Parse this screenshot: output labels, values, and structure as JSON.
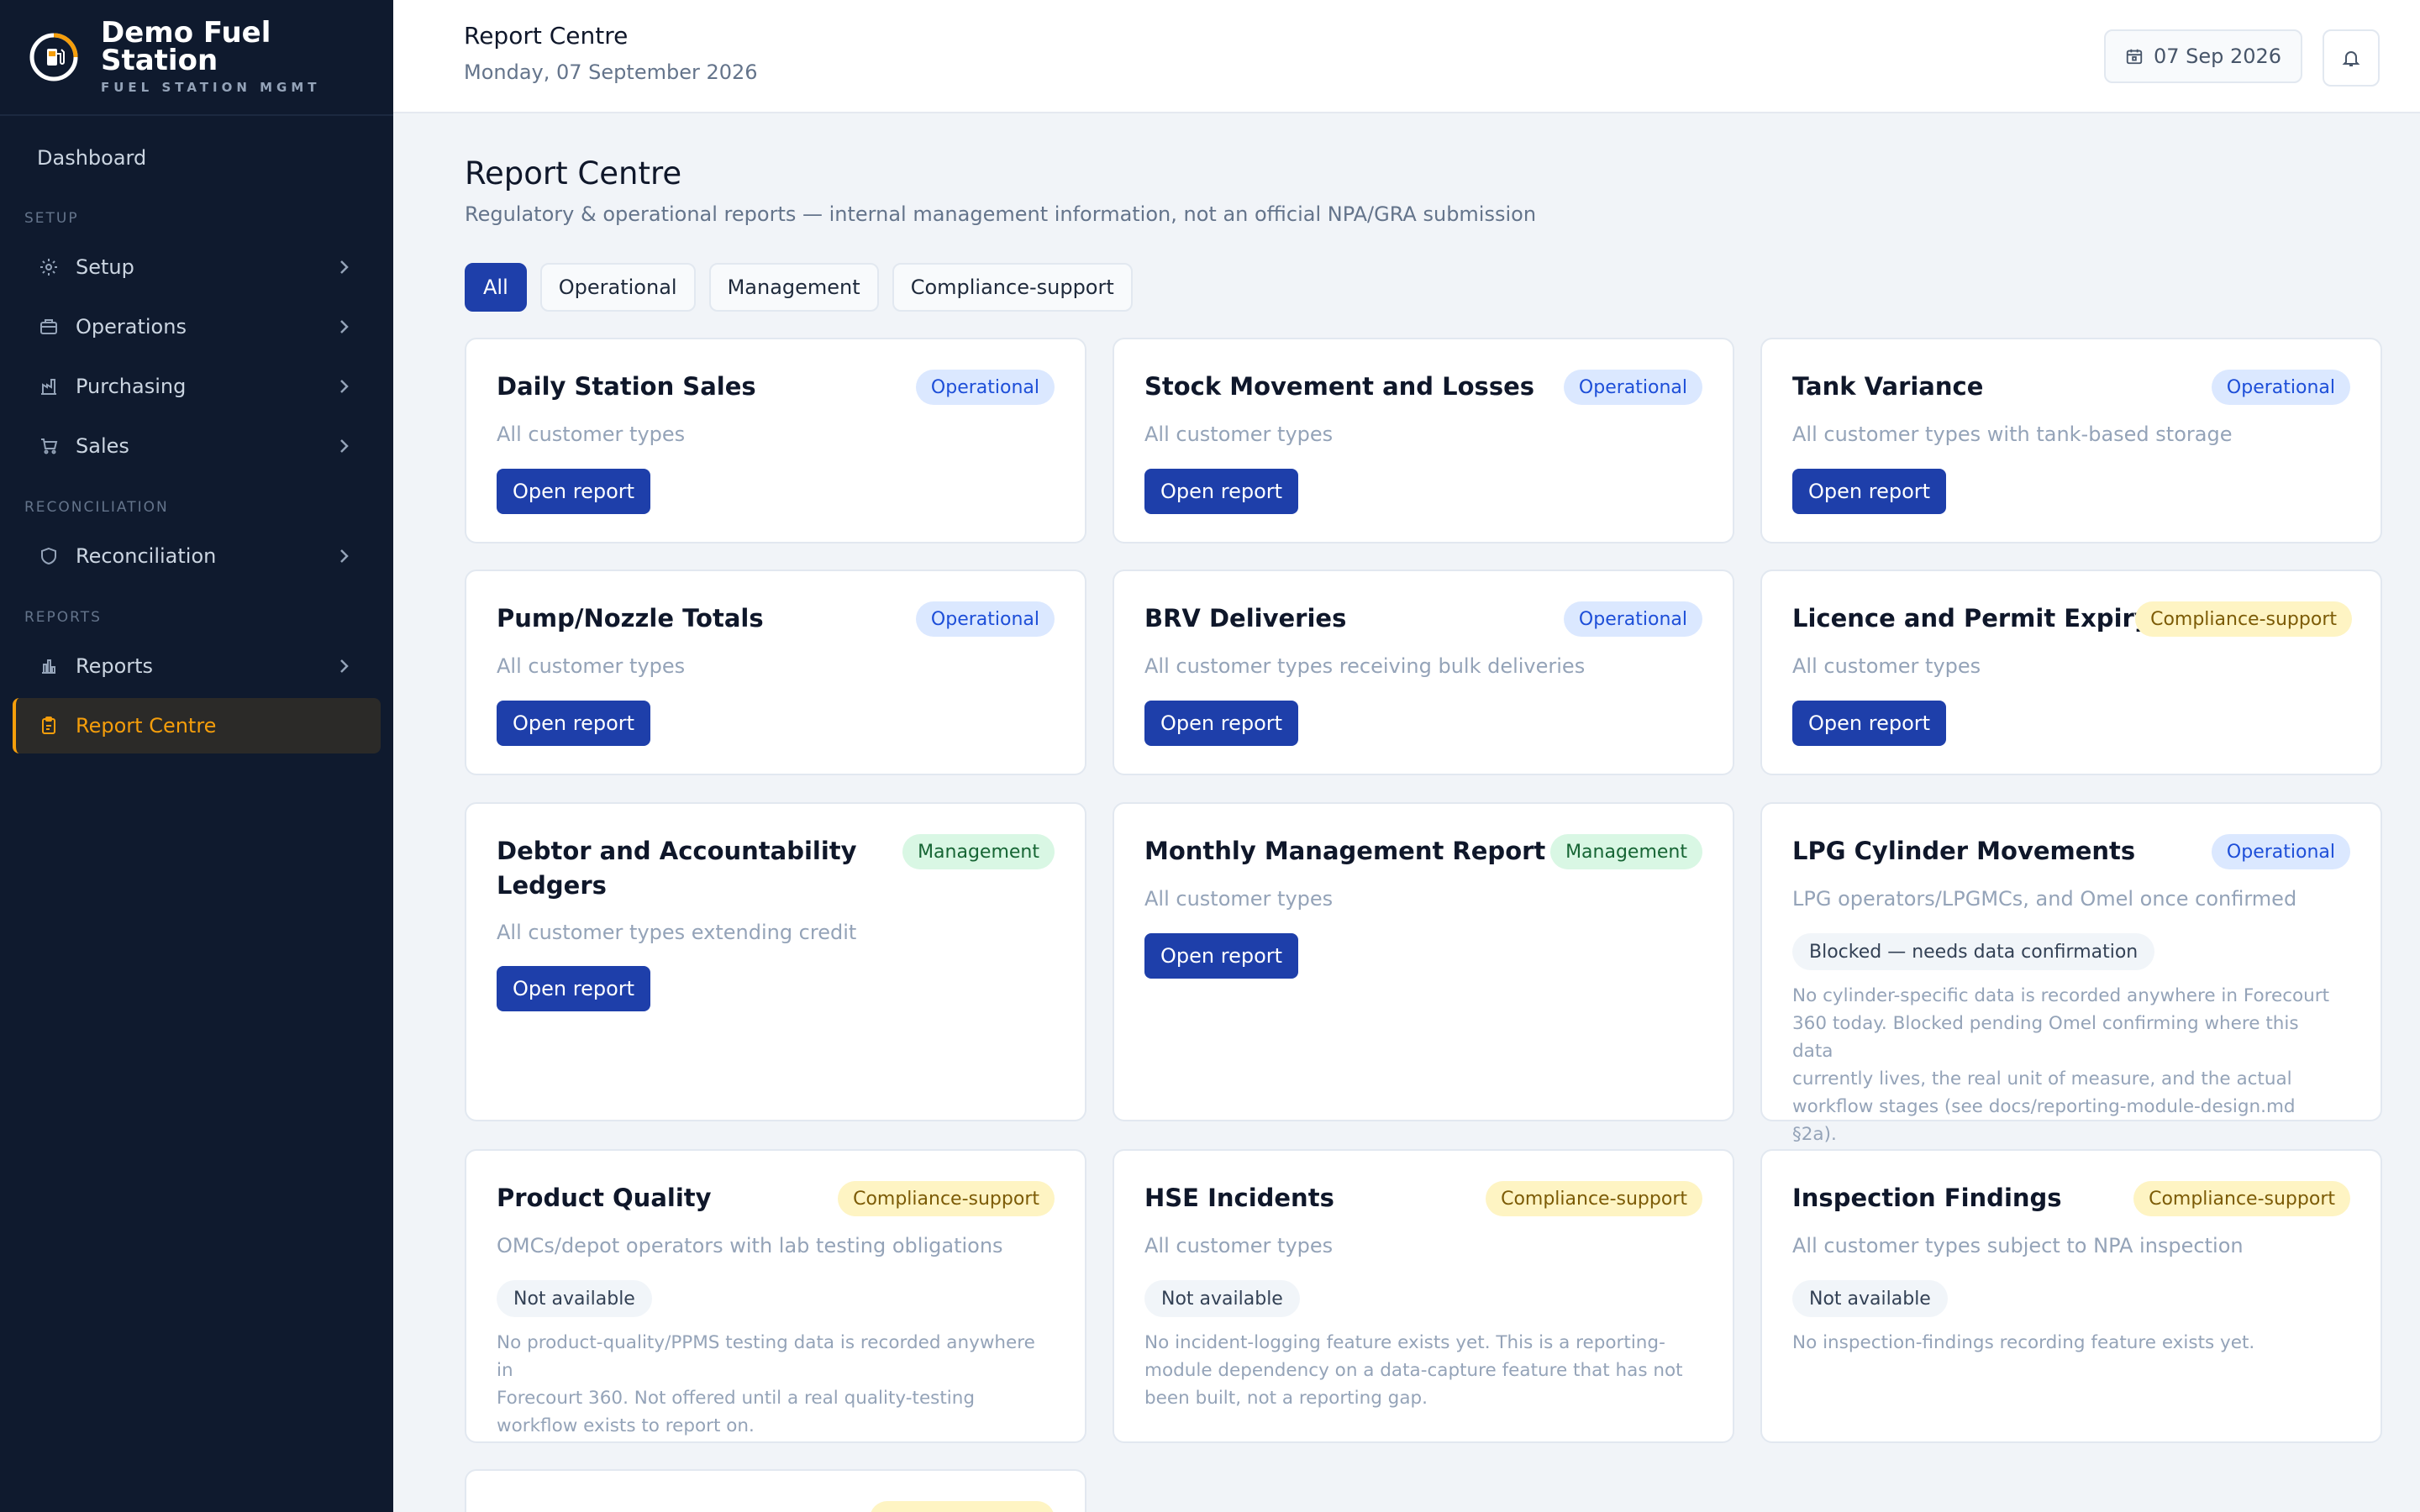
{
  "brand": {
    "name": "Demo Fuel Station",
    "name_line1": "Demo Fuel",
    "name_line2": "Station",
    "subtitle": "FUEL STATION MGMT",
    "accent": "#f59e0b"
  },
  "sidebar": {
    "dashboard": "Dashboard",
    "sections": {
      "setup": "SETUP",
      "reconciliation": "RECONCILIATION",
      "reports": "REPORTS"
    },
    "items": [
      {
        "label": "Setup",
        "icon": "gear-icon"
      },
      {
        "label": "Operations",
        "icon": "briefcase-icon"
      },
      {
        "label": "Purchasing",
        "icon": "factory-icon"
      },
      {
        "label": "Sales",
        "icon": "cart-icon"
      },
      {
        "label": "Reconciliation",
        "icon": "shield-icon"
      },
      {
        "label": "Reports",
        "icon": "bar-chart-icon"
      },
      {
        "label": "Report Centre",
        "icon": "clipboard-icon",
        "active": true
      }
    ]
  },
  "topbar": {
    "title": "Report Centre",
    "date_long": "Monday, 07 September 2026",
    "date_short": "07 Sep 2026"
  },
  "main": {
    "title": "Report Centre",
    "subtitle": "Regulatory & operational reports — internal management information, not an official NPA/GRA submission",
    "filters": [
      "All",
      "Operational",
      "Management",
      "Compliance-support"
    ],
    "active_filter": "All"
  },
  "cards": [
    {
      "title": "Daily Station Sales",
      "badge": "Operational",
      "desc": "All customer types",
      "button": "Open report"
    },
    {
      "title": "Stock Movement and Losses",
      "badge": "Operational",
      "desc": "All customer types",
      "button": "Open report"
    },
    {
      "title": "Tank Variance",
      "badge": "Operational",
      "desc": "All customer types with tank-based storage",
      "button": "Open report"
    },
    {
      "title": "Pump/Nozzle Totals",
      "badge": "Operational",
      "desc": "All customer types",
      "button": "Open report"
    },
    {
      "title": "BRV Deliveries",
      "badge": "Operational",
      "desc": "All customer types receiving bulk deliveries",
      "button": "Open report"
    },
    {
      "title": "Licence and Permit Expiry",
      "badge": "Compliance-support",
      "desc": "All customer types",
      "button": "Open report"
    },
    {
      "title_line1": "Debtor and Accountability",
      "title_line2": "Ledgers",
      "badge": "Management",
      "desc": "All customer types extending credit",
      "button": "Open report"
    },
    {
      "title": "Monthly Management Report",
      "badge": "Management",
      "desc": "All customer types",
      "button": "Open report"
    },
    {
      "title": "LPG Cylinder Movements",
      "badge": "Operational",
      "desc": "LPG operators/LPGMCs, and Omel once confirmed",
      "status": "Blocked — needs data confirmation",
      "note": [
        "No cylinder-specific data is recorded anywhere in Forecourt",
        "360 today. Blocked pending Omel confirming where this data",
        "currently lives, the real unit of measure, and the actual",
        "workflow stages (see docs/reporting-module-design.md §2a)."
      ]
    },
    {
      "title": "Product Quality",
      "badge": "Compliance-support",
      "desc": "OMCs/depot operators with lab testing obligations",
      "status": "Not available",
      "note": [
        "No product-quality/PPMS testing data is recorded anywhere in",
        "Forecourt 360. Not offered until a real quality-testing",
        "workflow exists to report on."
      ]
    },
    {
      "title": "HSE Incidents",
      "badge": "Compliance-support",
      "desc": "All customer types",
      "status": "Not available",
      "note": [
        "No incident-logging feature exists yet. This is a reporting-",
        "module dependency on a data-capture feature that has not",
        "been built, not a reporting gap."
      ]
    },
    {
      "title": "Inspection Findings",
      "badge": "Compliance-support",
      "desc": "All customer types subject to NPA inspection",
      "status": "Not available",
      "note": [
        "No inspection-findings recording feature exists yet."
      ]
    }
  ]
}
